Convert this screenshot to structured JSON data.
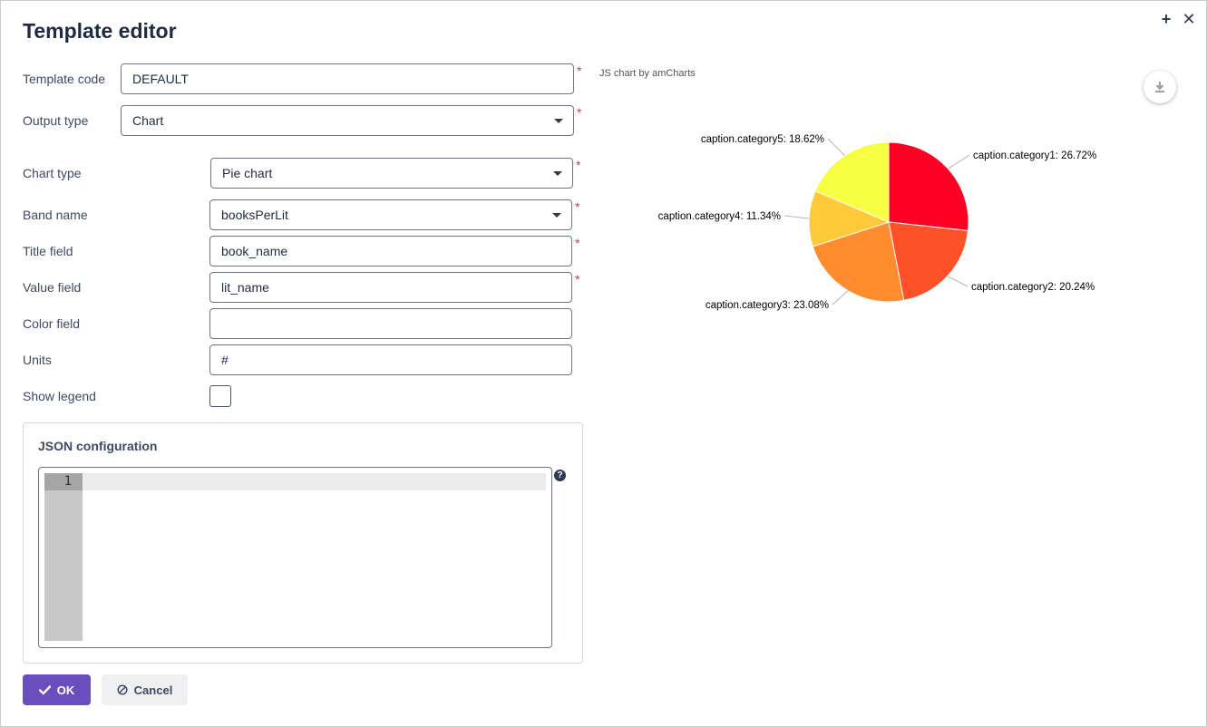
{
  "dialog": {
    "title": "Template editor",
    "maximize_icon": "plus-icon",
    "close_icon": "close-icon"
  },
  "form": {
    "template_code": {
      "label": "Template code",
      "value": "DEFAULT"
    },
    "output_type": {
      "label": "Output type",
      "value": "Chart"
    },
    "chart_type": {
      "label": "Chart type",
      "value": "Pie chart"
    },
    "band_name": {
      "label": "Band name",
      "value": "booksPerLit"
    },
    "title_field": {
      "label": "Title field",
      "value": "book_name"
    },
    "value_field": {
      "label": "Value field",
      "value": "lit_name"
    },
    "color_field": {
      "label": "Color field",
      "value": ""
    },
    "units": {
      "label": "Units",
      "value": "#"
    },
    "show_legend": {
      "label": "Show legend",
      "checked": false
    },
    "required_mark": "*"
  },
  "json_config": {
    "title": "JSON configuration",
    "line_number": "1",
    "help_icon": "question-icon",
    "help_glyph": "?"
  },
  "buttons": {
    "ok": "OK",
    "ok_icon": "check-icon",
    "cancel": "Cancel",
    "cancel_icon": "ban-icon"
  },
  "preview": {
    "credit": "JS chart by amCharts",
    "download_icon": "download-icon"
  },
  "chart_data": {
    "type": "pie",
    "categories": [
      "caption.category1",
      "caption.category2",
      "caption.category3",
      "caption.category4",
      "caption.category5"
    ],
    "values": [
      26.72,
      20.24,
      23.08,
      11.34,
      18.62
    ],
    "labels": [
      "caption.category1: 26.72%",
      "caption.category2: 20.24%",
      "caption.category3: 23.08%",
      "caption.category4: 11.34%",
      "caption.category5: 18.62%"
    ],
    "colors": [
      "#ff0024",
      "#ff5128",
      "#ff8c2f",
      "#ffc937",
      "#f6ff41"
    ],
    "legend": false
  }
}
